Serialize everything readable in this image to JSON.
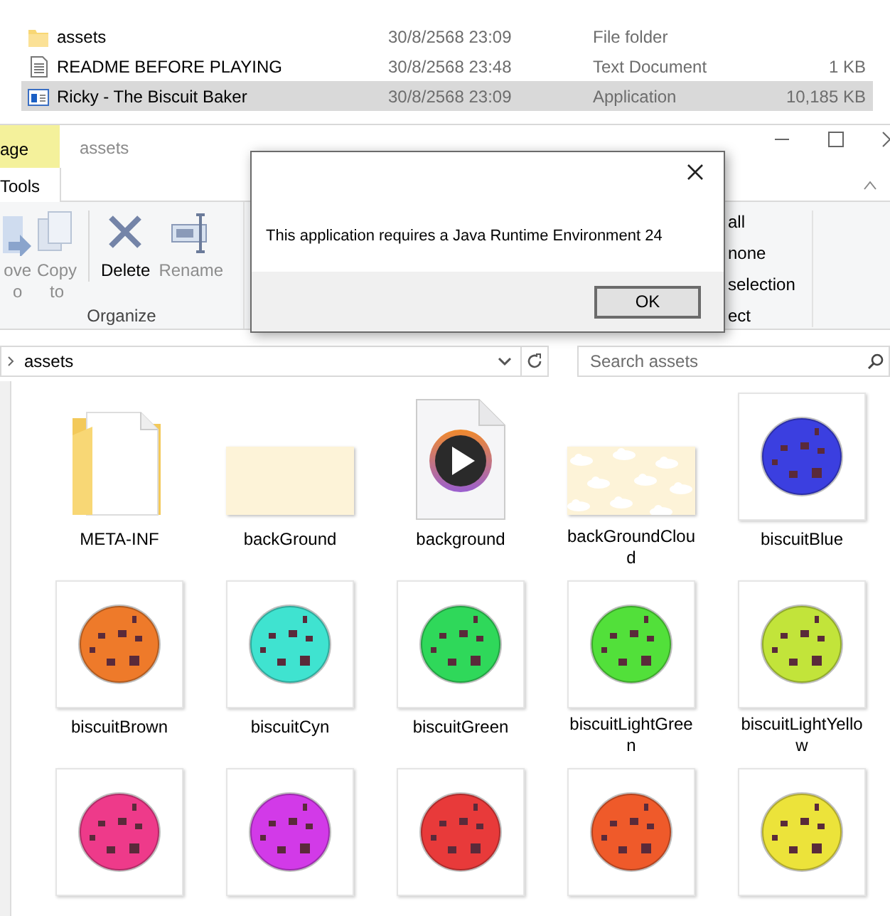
{
  "file_list": [
    {
      "name": "assets",
      "date": "30/8/2568 23:09",
      "type": "File folder",
      "kind": "folder",
      "selected": false
    },
    {
      "name": "README BEFORE PLAYING",
      "date": "30/8/2568 23:48",
      "type": "Text Document",
      "size": "1 KB",
      "kind": "text",
      "selected": false
    },
    {
      "name": "Ricky - The Biscuit Baker",
      "date": "30/8/2568 23:09",
      "type": "Application",
      "size": "10,185 KB",
      "kind": "app",
      "selected": true
    }
  ],
  "explorer": {
    "context_tab": "age",
    "title": "assets",
    "tools_tab": "Tools",
    "ribbon_buttons": [
      {
        "label": "ove\no",
        "kind": "move",
        "disabled": true
      },
      {
        "label": "Copy\nto",
        "kind": "copy",
        "disabled": true
      },
      {
        "label": "Delete",
        "kind": "delete",
        "disabled": false
      },
      {
        "label": "Rename",
        "kind": "rename",
        "disabled": true
      }
    ],
    "group_label": "Organize",
    "select_items": [
      "all",
      "none",
      "selection",
      "ect"
    ],
    "address": "assets",
    "search": {
      "placeholder": "Search assets"
    },
    "items": [
      {
        "name": "META-INF",
        "kind": "folder"
      },
      {
        "name": "backGround",
        "kind": "plain-image"
      },
      {
        "name": "background",
        "kind": "media"
      },
      {
        "name": "backGroundCloud",
        "kind": "clouds"
      },
      {
        "name": "biscuitBlue",
        "kind": "biscuit",
        "color": "#3b3fe0"
      },
      {
        "name": "biscuitBrown",
        "kind": "biscuit",
        "color": "#ee7a2a"
      },
      {
        "name": "biscuitCyn",
        "kind": "biscuit",
        "color": "#3fe3d0"
      },
      {
        "name": "biscuitGreen",
        "kind": "biscuit",
        "color": "#2fd85a"
      },
      {
        "name": "biscuitLightGreen",
        "kind": "biscuit",
        "color": "#52e03a"
      },
      {
        "name": "biscuitLightYellow",
        "kind": "biscuit",
        "color": "#c2e43a"
      },
      {
        "kind": "biscuit",
        "color": "#ee3a8a"
      },
      {
        "kind": "biscuit",
        "color": "#d23ae8"
      },
      {
        "kind": "biscuit",
        "color": "#e83a3a"
      },
      {
        "kind": "biscuit",
        "color": "#ef5a2a"
      },
      {
        "kind": "biscuit",
        "color": "#ece33a"
      }
    ]
  },
  "dialog": {
    "message": "This application requires a Java Runtime Environment 24",
    "button": "OK"
  }
}
